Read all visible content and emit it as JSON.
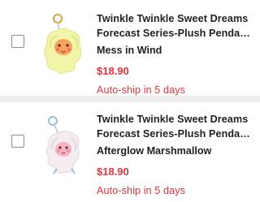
{
  "items": [
    {
      "title_line1": "Twinkle Twinkle Sweet Dreams",
      "title_line2": "Forecast Series-Plush Pendant Blind Box",
      "variant": "Mess in Wind",
      "price": "$18.90",
      "autoship": "Auto-ship in 5 days",
      "colors": {
        "plush": "#f2f4a8",
        "plush_shade": "#dfe58a",
        "face": "#f7a15c",
        "cheeks": "#f26b5b",
        "ring": "#d9a441"
      }
    },
    {
      "title_line1": "Twinkle Twinkle Sweet Dreams",
      "title_line2": "Forecast Series-Plush Pendant Blind Box",
      "variant": "Afterglow Marshmallow",
      "price": "$18.90",
      "autoship": "Auto-ship in 5 days",
      "colors": {
        "plush": "#f4ecf1",
        "plush_shade": "#e3d6e0",
        "face": "#f6b4c2",
        "cheeks": "#ef8aa2",
        "ring": "#9bbbe0"
      }
    }
  ],
  "accent_color": "#e2333e"
}
